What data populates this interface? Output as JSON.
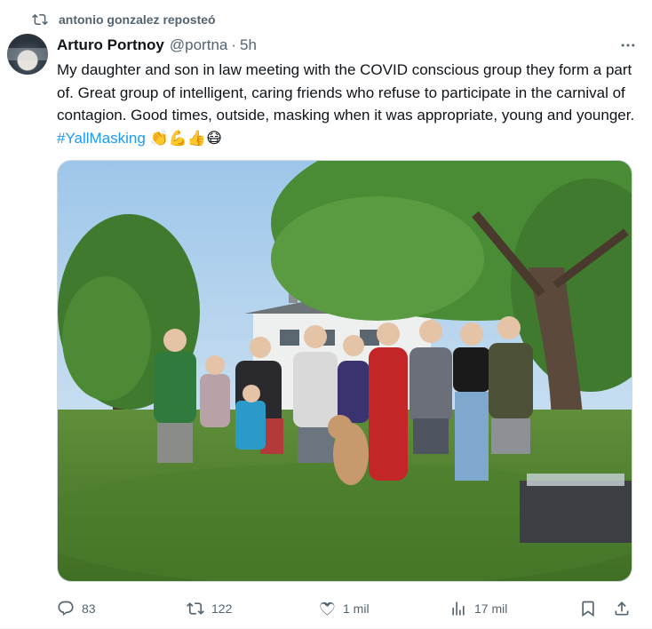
{
  "repost": {
    "icon": "retweet-icon",
    "text": "antonio gonzalez reposteó"
  },
  "author": {
    "name": "Arturo Portnoy",
    "handle": "@portna",
    "separator": "·",
    "time": "5h",
    "avatar_icon": "avatar-image"
  },
  "tweet": {
    "text": "My daughter and son in law meeting with the COVID conscious group they form a part of. Great group of intelligent, caring friends who refuse to participate in the carnival of contagion. Good times, outside, masking when it was appropriate, young and younger.",
    "hashtag": "#YallMasking",
    "emojis": "👏💪👍😷"
  },
  "media": {
    "description_icon": "group-photo-image"
  },
  "actions": {
    "replies": "83",
    "reposts": "122",
    "likes": "1 mil",
    "views": "17 mil"
  },
  "colors": {
    "accent": "#1d9bf0",
    "muted": "#536471",
    "text": "#0f1419"
  }
}
